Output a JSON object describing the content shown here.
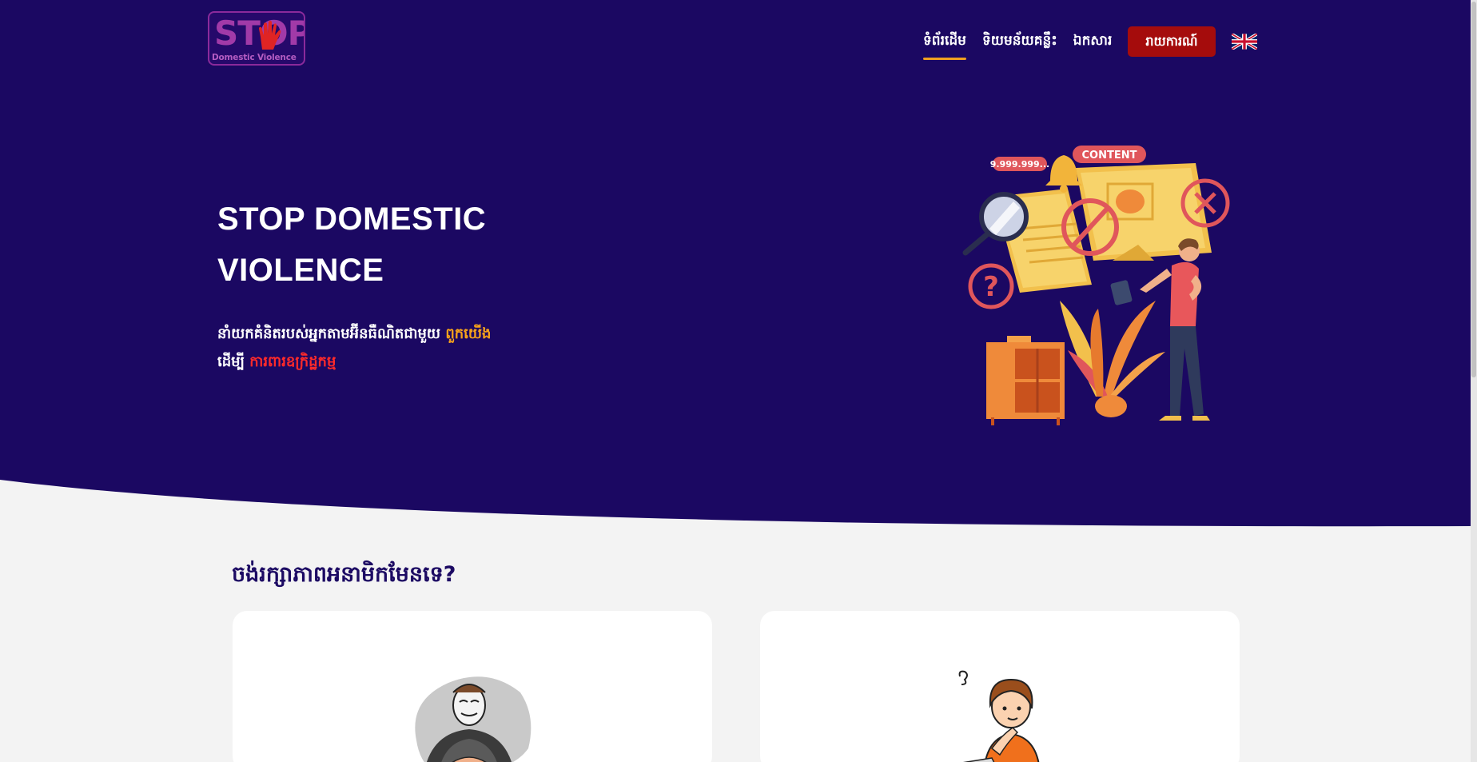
{
  "header": {
    "logo_text": "STOP",
    "logo_subtext": "Domestic Violence"
  },
  "nav": {
    "items": [
      {
        "label": "ទំព័រដើម",
        "active": true
      },
      {
        "label": "ទិយមន័យគន្លឹះ",
        "active": false
      },
      {
        "label": "ឯកសារ",
        "active": false
      }
    ],
    "report_button": "រាយការណ៍",
    "language_icon": "uk-flag-icon"
  },
  "hero": {
    "title_line1": "STOP DOMESTIC",
    "title_line2": "VIOLENCE",
    "subtitle_part1": "នាំយកគំនិតរបស់អ្នកតាមអ៊ីនធឺណិតជាមួយ ",
    "subtitle_highlight1": "ពួកយើង",
    "subtitle_part2": "ដើម្បី ",
    "subtitle_highlight2": "ការពារឧក្រិដ្ឋកម្ម",
    "illustration_badge_count": "9.999.999...",
    "illustration_badge_content": "CONTENT"
  },
  "section": {
    "title": "ចង់រក្សាភាពអនាមិកមែនទេ?"
  },
  "colors": {
    "hero_bg": "#1b0862",
    "accent_orange": "#f6a21b",
    "accent_red": "#ff2a2a",
    "report_button": "#a50c0c",
    "page_bg": "#f3f3f3"
  }
}
